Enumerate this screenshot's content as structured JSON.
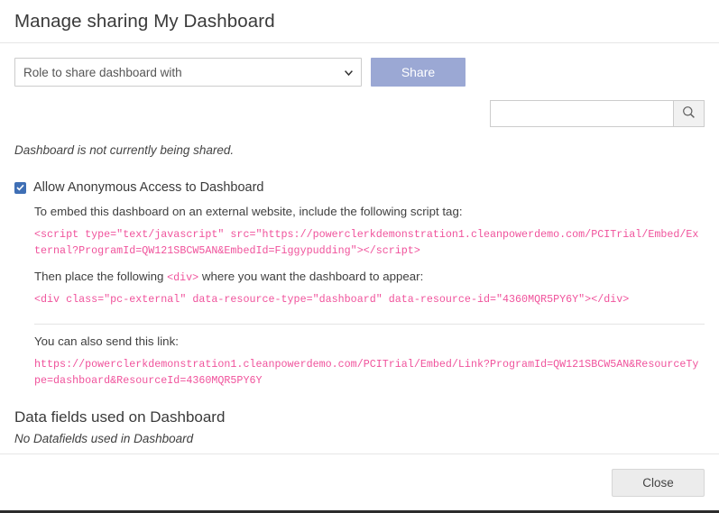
{
  "dialog": {
    "title": "Manage sharing My Dashboard",
    "close_label": "Close"
  },
  "share": {
    "role_select_value": "Role to share dashboard with",
    "share_button_label": "Share",
    "status_text": "Dashboard is not currently being shared.",
    "search_value": "",
    "search_placeholder": "",
    "search_icon": "search-icon",
    "chevron_icon": "chevron-down-icon"
  },
  "anonymous": {
    "checkbox_checked": true,
    "label": "Allow Anonymous Access to Dashboard",
    "embed_hint": "To embed this dashboard on an external website, include the following script tag:",
    "script_tag": "<script type=\"text/javascript\" src=\"https://powerclerkdemonstration1.cleanpowerdemo.com/PCITrial/Embed/External?ProgramId=QW121SBCW5AN&EmbedId=Figgypudding\"></script>",
    "div_hint_before": "Then place the following ",
    "div_hint_code": "<div>",
    "div_hint_after": " where you want the dashboard to appear:",
    "div_tag": "<div class=\"pc-external\" data-resource-type=\"dashboard\" data-resource-id=\"4360MQR5PY6Y\"></div>",
    "link_hint": "You can also send this link:",
    "link_url": "https://powerclerkdemonstration1.cleanpowerdemo.com/PCITrial/Embed/Link?ProgramId=QW121SBCW5AN&ResourceType=dashboard&ResourceId=4360MQR5PY6Y"
  },
  "datafields": {
    "title": "Data fields used on Dashboard",
    "empty_text": "No Datafields used in Dashboard"
  },
  "colors": {
    "share_button": "#9ba8d4",
    "code_text": "#f0539c",
    "checkbox": "#3f6fb5"
  }
}
